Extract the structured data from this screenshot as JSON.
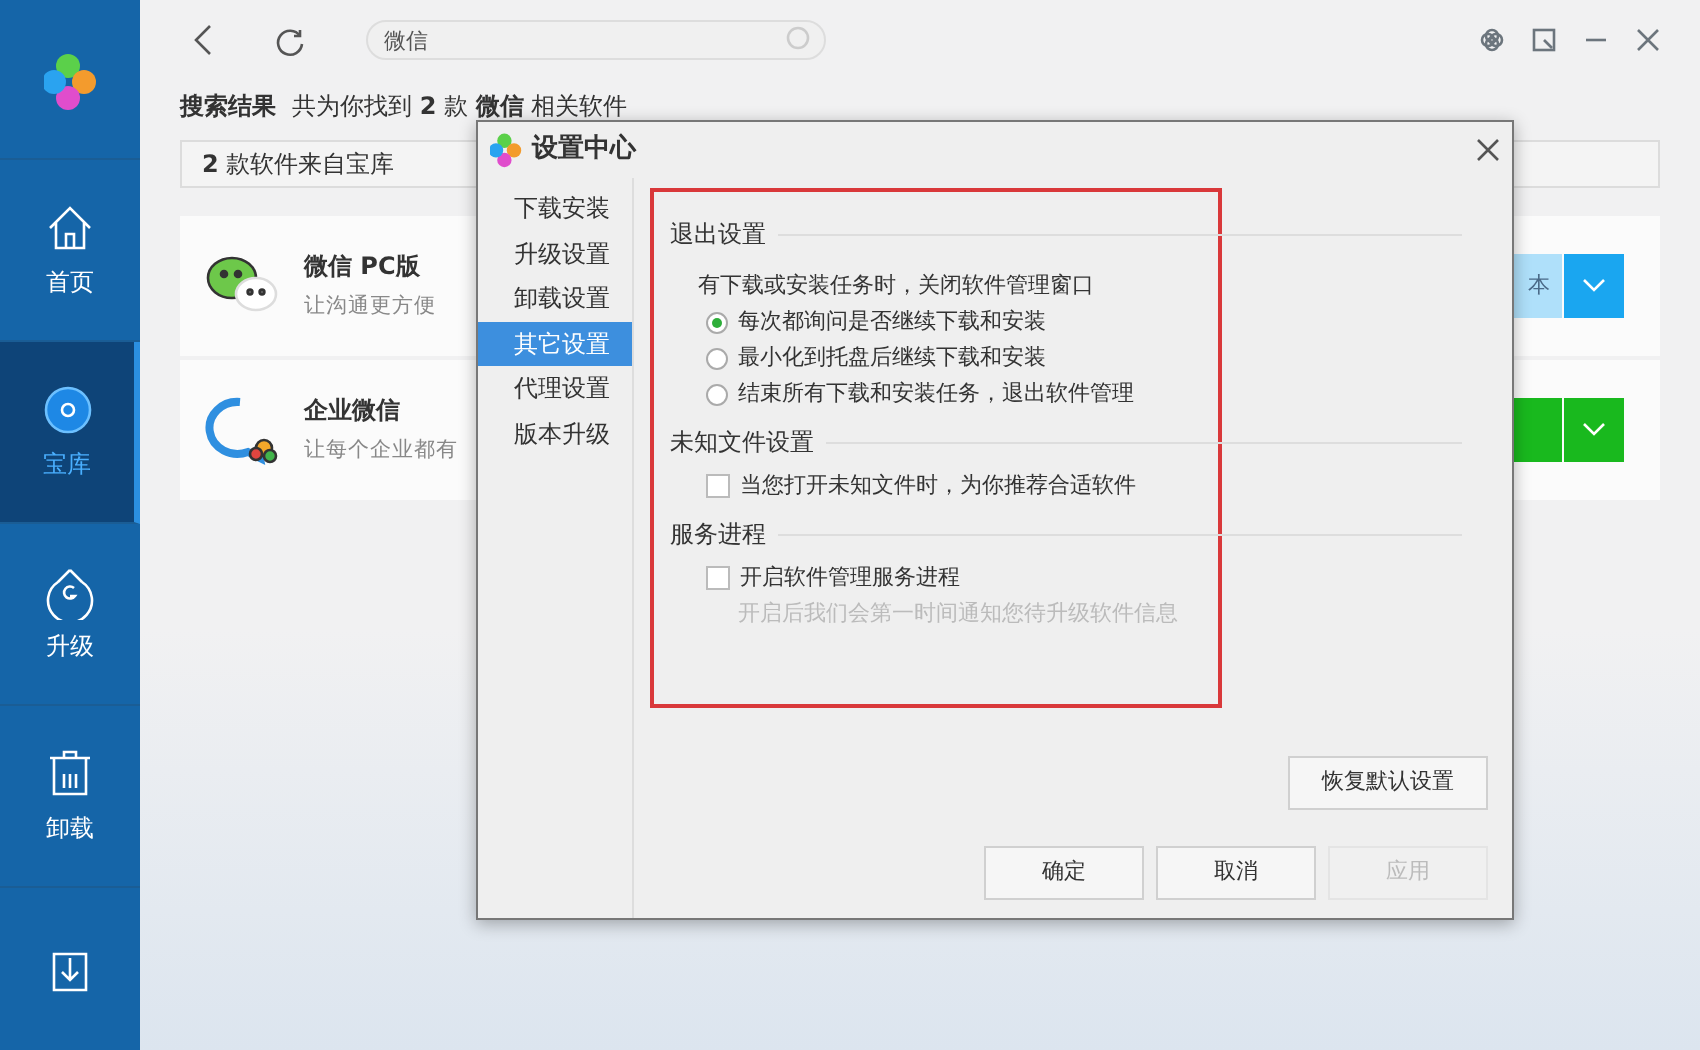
{
  "sidebar": {
    "items": [
      {
        "kind": "home",
        "label": "首页",
        "selected": false
      },
      {
        "kind": "library",
        "label": "宝库",
        "selected": true
      },
      {
        "kind": "upgrade",
        "label": "升级",
        "selected": false
      },
      {
        "kind": "uninstall",
        "label": "卸载",
        "selected": false
      },
      {
        "kind": "download",
        "selected": false
      }
    ]
  },
  "toolbar": {
    "search": {
      "value": "微信"
    }
  },
  "results": {
    "heading": "搜索结果",
    "summary": "共为你找到 **2** 款 **微信** 相关软件",
    "source": "**2** 款软件来自宝库",
    "apps": [
      {
        "kind": "wechat",
        "name": "微信 PC版",
        "description": "让沟通更方便",
        "button": "本",
        "color": "#1aa6f0"
      },
      {
        "kind": "wecom",
        "name": "企业微信",
        "description": "让每个企业都有",
        "color": "#19b91e"
      }
    ]
  },
  "dialog": {
    "title": "设置中心",
    "nav": [
      {
        "label": "下载安装",
        "selected": false
      },
      {
        "label": "升级设置",
        "selected": false
      },
      {
        "label": "卸载设置",
        "selected": false
      },
      {
        "label": "其它设置",
        "selected": true
      },
      {
        "label": "代理设置",
        "selected": false
      },
      {
        "label": "版本升级",
        "selected": false
      }
    ],
    "sections": [
      {
        "title": "退出设置",
        "items": [
          {
            "kind": "note",
            "label": "有下载或安装任务时，关闭软件管理窗口"
          },
          {
            "kind": "radio",
            "label": "每次都询问是否继续下载和安装",
            "selected": true
          },
          {
            "kind": "radio",
            "label": "最小化到托盘后继续下载和安装",
            "selected": false
          },
          {
            "kind": "radio",
            "label": "结束所有下载和安装任务，退出软件管理",
            "selected": false
          }
        ]
      },
      {
        "title": "未知文件设置",
        "items": [
          {
            "kind": "checkbox",
            "label": "当您打开未知文件时，为你推荐合适软件",
            "checked": false
          }
        ]
      },
      {
        "title": "服务进程",
        "items": [
          {
            "kind": "checkbox",
            "label": "开启软件管理服务进程",
            "checked": false
          },
          {
            "kind": "hint",
            "label": "开启后我们会第一时间通知您待升级软件信息"
          }
        ]
      }
    ],
    "restore_button": "恢复默认设置",
    "buttons": [
      {
        "label": "确定",
        "disabled": false
      },
      {
        "label": "取消",
        "disabled": false
      },
      {
        "label": "应用",
        "disabled": true
      }
    ]
  }
}
